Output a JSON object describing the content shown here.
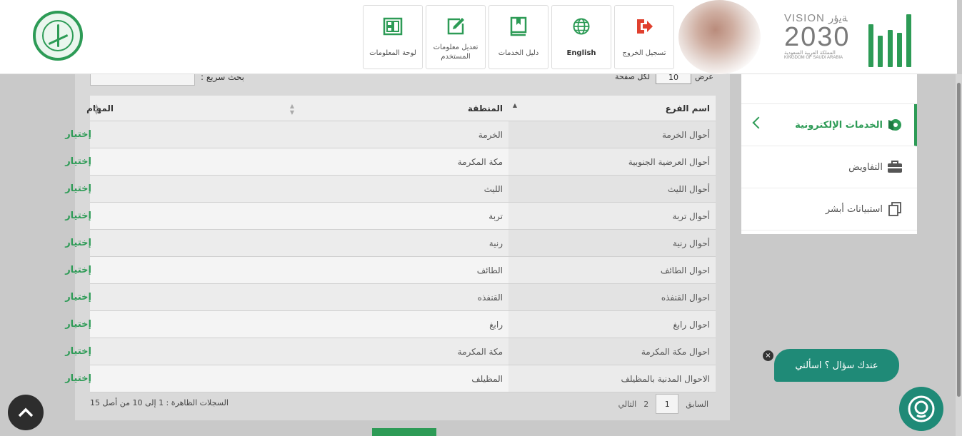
{
  "header": {
    "nav": [
      {
        "key": "dashboard",
        "label": "لوحة المعلومات",
        "icon": "dashboard-icon"
      },
      {
        "key": "edit_user",
        "label": "تعديل معلومات المستخدم",
        "icon": "edit-icon"
      },
      {
        "key": "services_guide",
        "label": "دليل الخدمات",
        "icon": "book-icon"
      },
      {
        "key": "english",
        "label": "English",
        "icon": "globe-icon"
      },
      {
        "key": "logout",
        "label": "تسجيل الخروج",
        "icon": "logout-icon"
      }
    ],
    "vision": {
      "top": "VISION ﺔﻳﺅﺭ",
      "year": "2030",
      "ar": "المملكة العربية السعودية",
      "en": "KINGDOM OF SAUDI ARABIA"
    }
  },
  "sidebar": {
    "items": [
      {
        "label": "الخدمات الإلكترونية",
        "icon": "eservices-icon",
        "active": true
      },
      {
        "label": "التفاويض",
        "icon": "briefcase-icon",
        "active": false
      },
      {
        "label": "استبيانات أبشر",
        "icon": "copy-icon",
        "active": false
      }
    ]
  },
  "controls": {
    "search_label": "بحث سريع :",
    "show_label": "عرض",
    "page_size": "10",
    "page_size_label": "لكل صفحة"
  },
  "table": {
    "columns": [
      "اسم الفرع",
      "المنطقة",
      "المهام"
    ],
    "rows": [
      {
        "branch": "أحوال الخرمة",
        "region": "الخرمة",
        "action": "إختيار"
      },
      {
        "branch": "أحوال العرضية الجنوبية",
        "region": "مكة المكرمة",
        "action": "إختيار"
      },
      {
        "branch": "أحوال الليث",
        "region": "الليث",
        "action": "إختيار"
      },
      {
        "branch": "أحوال تربة",
        "region": "تربة",
        "action": "إختيار"
      },
      {
        "branch": "أحوال رنية",
        "region": "رنية",
        "action": "إختيار"
      },
      {
        "branch": "احوال الطائف",
        "region": "الطائف",
        "action": "إختيار"
      },
      {
        "branch": "احوال القنفذه",
        "region": "القنفذه",
        "action": "إختيار"
      },
      {
        "branch": "احوال رابغ",
        "region": "رابغ",
        "action": "إختيار"
      },
      {
        "branch": "احوال مكة المكرمة",
        "region": "مكة المكرمة",
        "action": "إختيار"
      },
      {
        "branch": "الاحوال المدنية بالمظيلف",
        "region": "المظيلف",
        "action": "إختيار"
      }
    ]
  },
  "pagination": {
    "prev": "السابق",
    "pages": [
      "1",
      "2"
    ],
    "next": "التالي",
    "records_info": "السجلات الظاهرة : 1 إلى 10 من أصل 15"
  },
  "chat": {
    "text": "عندك سؤال ؟ اسألني",
    "close": "×"
  },
  "colors": {
    "brand_green": "#2d9b56",
    "chat_teal": "#1f8a77",
    "logout_red": "#e0402e",
    "header_bg": "#ffffff"
  }
}
